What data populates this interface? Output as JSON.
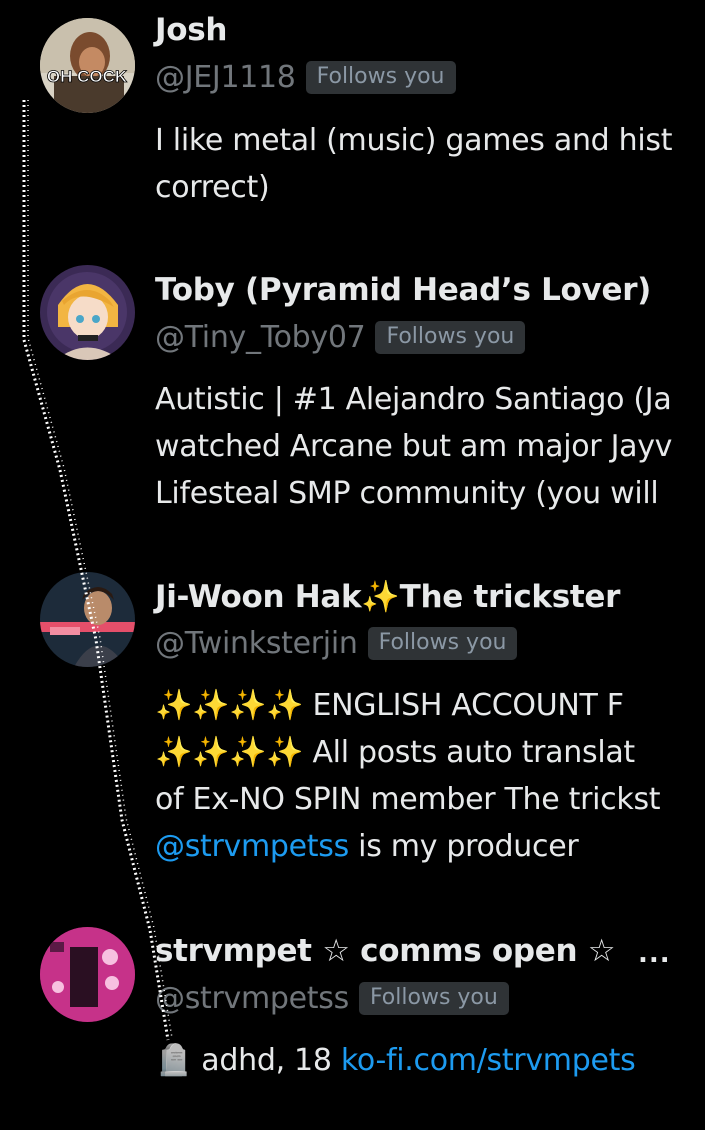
{
  "users": [
    {
      "name": "Josh",
      "handle": "@JEJ1118",
      "follows_badge": "Follows you",
      "avatar_caption": "OH COCK",
      "bio_lines": [
        "I like metal (music) games and hist",
        "correct)"
      ]
    },
    {
      "name": "Toby (Pyramid Head’s Lover)",
      "handle": "@Tiny_Toby07",
      "follows_badge": "Follows you",
      "bio_lines": [
        "Autistic | #1 Alejandro Santiago (Ja",
        "watched Arcane but am major Jayv",
        "Lifesteal SMP community (you will"
      ]
    },
    {
      "name_part1": "Ji-Woon Hak",
      "name_emoji": "✨",
      "name_part2": "The trickster",
      "handle": "@Twinksterjin",
      "follows_badge": "Follows you",
      "bio_line1_emoji": "✨✨✨✨",
      "bio_line1_text": " ENGLISH ACCOUNT F",
      "bio_line2_emoji": "✨✨✨✨",
      "bio_line2_text": " All posts auto translat",
      "bio_line3": "of Ex-NO SPIN member The trickst",
      "bio_line4_mention": "@strvmpetss",
      "bio_line4_text": " is my producer"
    },
    {
      "name": "strvmpet ☆ comms open ☆",
      "more_label": "...",
      "handle": "@strvmpetss",
      "follows_badge": "Follows you",
      "bio_prefix": "🪦 adhd, 18 ",
      "bio_link": "ko-fi.com/strvmpets"
    }
  ],
  "colors": {
    "background": "#000000",
    "text": "#e7e9ea",
    "secondary": "#71767b",
    "badge_bg": "#2f3336",
    "link": "#1d9bf0"
  }
}
